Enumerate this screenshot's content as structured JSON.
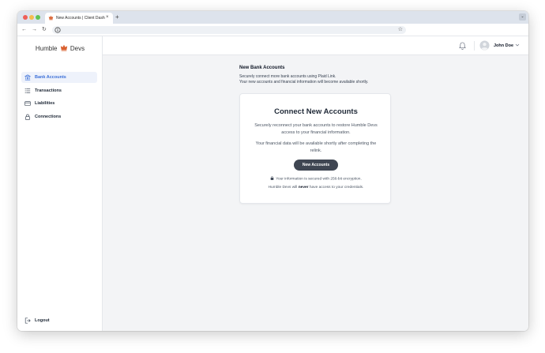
{
  "browser": {
    "tab_title": "New Accounts | Client Dashb",
    "tab_close": "×",
    "new_tab": "+",
    "tab_menu": "⌄",
    "back": "←",
    "forward": "→",
    "reload": "↻",
    "bookmark": "☆"
  },
  "brand": {
    "name_left": "Humble",
    "name_right": "Devs",
    "accent": "#d9602f"
  },
  "sidebar": {
    "items": [
      {
        "label": "Bank Accounts",
        "icon": "bank-icon",
        "active": true
      },
      {
        "label": "Transactions",
        "icon": "list-icon",
        "active": false
      },
      {
        "label": "Liabilities",
        "icon": "card-icon",
        "active": false
      },
      {
        "label": "Connections",
        "icon": "lock-icon",
        "active": false
      }
    ],
    "logout": {
      "label": "Logout",
      "icon": "logout-icon"
    }
  },
  "header": {
    "user_name": "John Doe",
    "icons": [
      "bell-icon",
      "avatar",
      "chevron-down-icon"
    ]
  },
  "main": {
    "title": "New Bank Accounts",
    "desc1": "Securely connect more bank accounts using Plaid Link.",
    "desc2": "Your new accounts and financial information will become available shortly.",
    "card": {
      "title": "Connect New Accounts",
      "p1": "Securely reconnect your bank accounts to restore Humble Devs access to your financial information.",
      "p2": "Your financial data will be available shortly after completing the relink.",
      "button": "New Accounts",
      "security": "Your information is secured with 256-bit encryption.",
      "never_prefix": "Humble Devs will",
      "never_word": "never",
      "never_suffix": "have access to your credentials."
    }
  },
  "colors": {
    "active_nav": "#3b6fd8",
    "button_bg": "#3f4652",
    "page_bg": "#f3f4f6"
  }
}
